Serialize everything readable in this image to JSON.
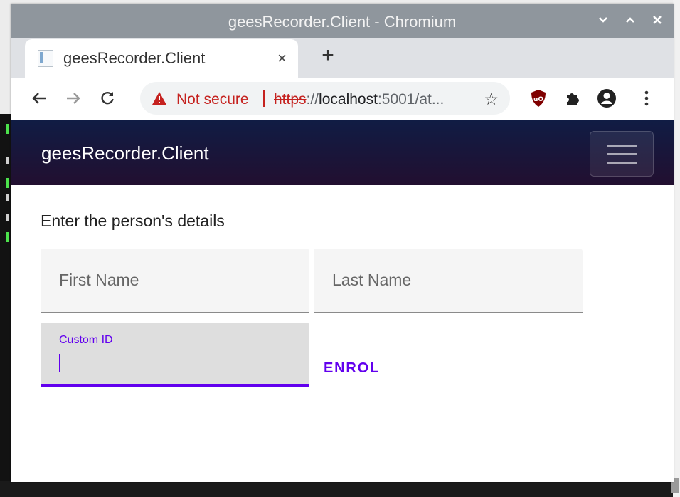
{
  "window": {
    "title": "geesRecorder.Client - Chromium"
  },
  "tab": {
    "title": "geesRecorder.Client",
    "close_glyph": "×",
    "new_tab_glyph": "+"
  },
  "omnibox": {
    "security_label": "Not secure",
    "url_scheme": "https",
    "url_sep": "://",
    "url_host": "localhost",
    "url_rest": ":5001/at..."
  },
  "app": {
    "brand": "geesRecorder.Client"
  },
  "form": {
    "prompt": "Enter the person's details",
    "first_name_placeholder": "First Name",
    "last_name_placeholder": "Last Name",
    "custom_id_label": "Custom ID",
    "enrol_label": "ENROL"
  },
  "colors": {
    "accent": "#6200ee",
    "header_top": "#101c44",
    "header_bottom": "#220f30",
    "insecure": "#c5221f"
  }
}
